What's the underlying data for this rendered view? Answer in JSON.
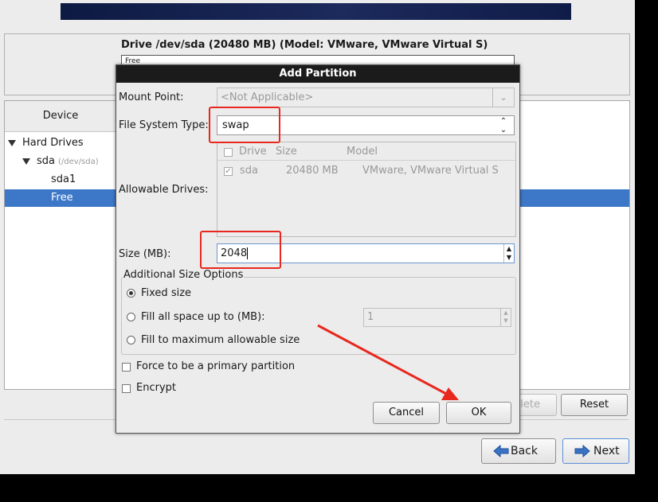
{
  "drive": {
    "title": "Drive /dev/sda (20480 MB) (Model: VMware, VMware Virtual S)",
    "bar_label": "Free"
  },
  "tree": {
    "header": "Device",
    "items": [
      {
        "label": "Hard Drives"
      },
      {
        "label": "sda",
        "sub": "(/dev/sda)"
      },
      {
        "label": "sda1"
      },
      {
        "label": "Free"
      }
    ]
  },
  "background_buttons": {
    "delete": "lete",
    "reset": "Reset"
  },
  "nav": {
    "back": "Back",
    "next": "Next"
  },
  "dialog": {
    "title": "Add Partition",
    "mount_point": {
      "label": "Mount Point:",
      "value": "<Not Applicable>"
    },
    "fs_type": {
      "label": "File System Type:",
      "value": "swap"
    },
    "drives": {
      "label": "Allowable Drives:",
      "columns": [
        "Drive",
        "Size",
        "Model"
      ],
      "rows": [
        {
          "drive": "sda",
          "size": "20480 MB",
          "model": "VMware, VMware Virtual S",
          "checked": true
        }
      ]
    },
    "size": {
      "label": "Size (MB):",
      "value": "2048"
    },
    "size_options": {
      "legend": "Additional Size Options",
      "fixed": "Fixed size",
      "fill_upto": "Fill all space up to (MB):",
      "fill_upto_value": "1",
      "fill_max": "Fill to maximum allowable size",
      "selected": "fixed"
    },
    "primary": "Force to be a primary partition",
    "encrypt": "Encrypt",
    "cancel": "Cancel",
    "ok": "OK"
  },
  "colors": {
    "selection": "#3d78c8",
    "annotation": "#e8281e",
    "banner": "#1c2a5c"
  }
}
